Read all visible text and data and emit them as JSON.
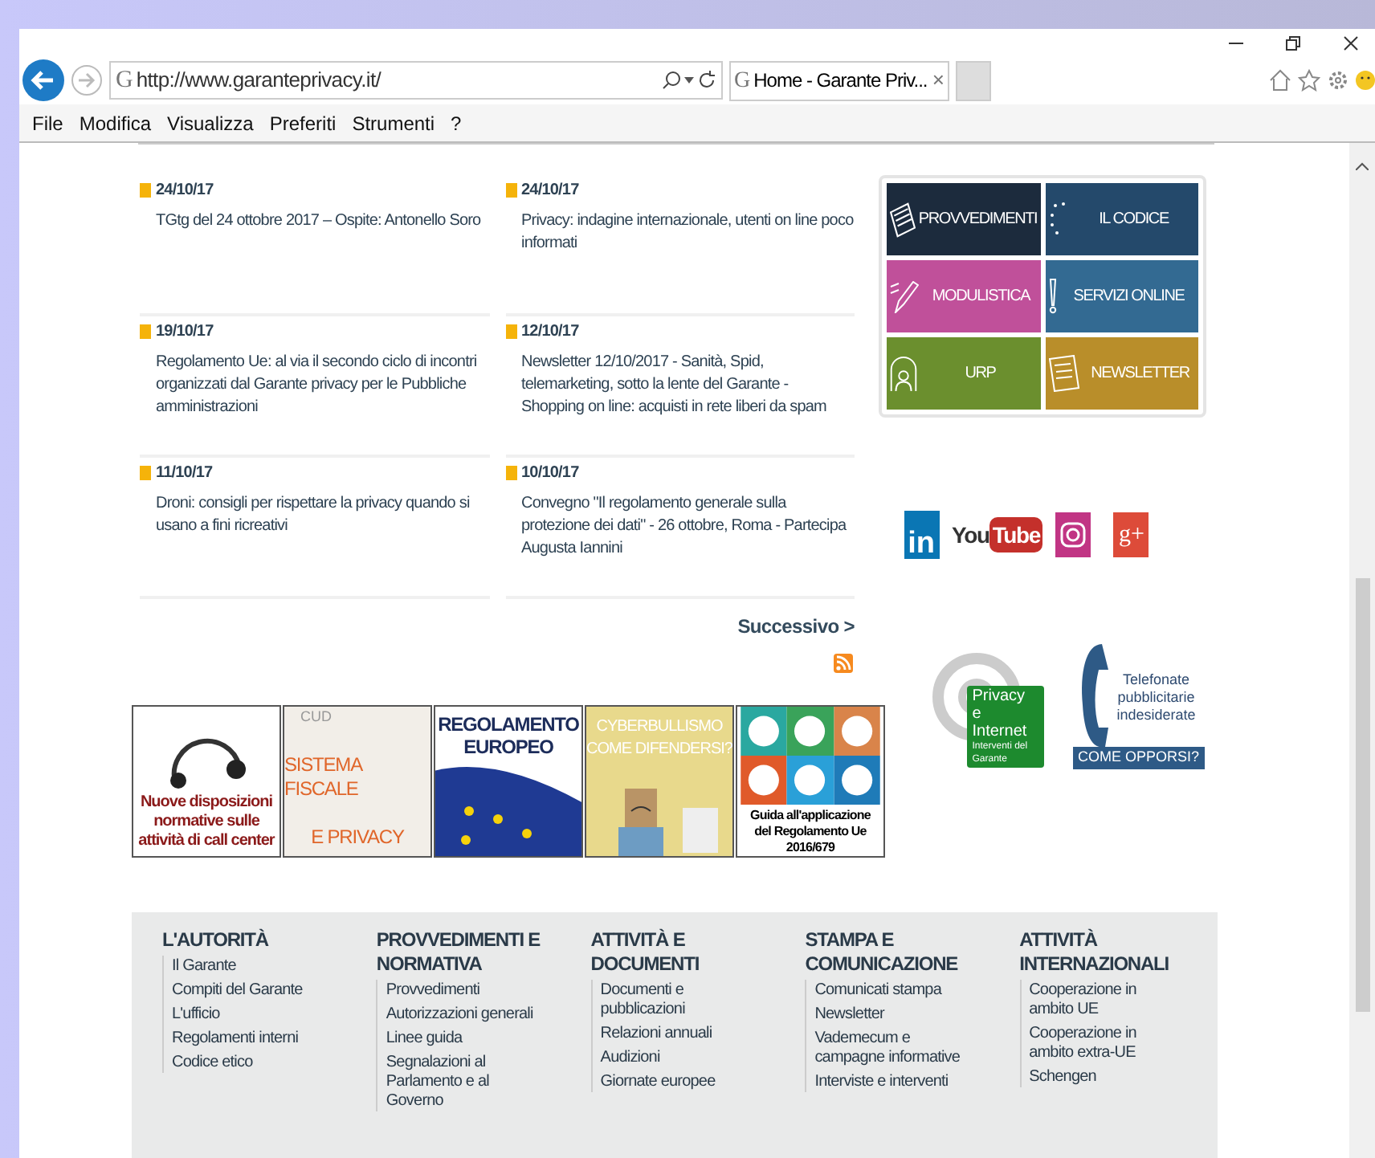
{
  "browser": {
    "site_icon": "G",
    "address": "http://www.garanteprivacy.it/",
    "tab": {
      "site_icon": "G",
      "title": "Home - Garante Priv...",
      "close": "×",
      "selected": true
    },
    "menu": [
      "File",
      "Modifica",
      "Visualizza",
      "Preferiti",
      "Strumenti",
      "?"
    ]
  },
  "news": [
    {
      "date": "24/10/17",
      "title": "TGtg del 24 ottobre 2017 – Ospite: Antonello Soro"
    },
    {
      "date": "24/10/17",
      "title": "Privacy: indagine internazionale, utenti on line poco informati"
    },
    {
      "date": "19/10/17",
      "title": "Regolamento Ue: al via il secondo ciclo di incontri organizzati dal Garante privacy per le Pubbliche amministrazioni"
    },
    {
      "date": "12/10/17",
      "title": "Newsletter 12/10/2017 - Sanità, Spid, telemarketing, sotto la lente del Garante - Shopping on line: acquisti in rete liberi da spam"
    },
    {
      "date": "11/10/17",
      "title": "Droni: consigli per rispettare la privacy quando si usano a fini ricreativi"
    },
    {
      "date": "10/10/17",
      "title": "Convegno \"Il regolamento generale sulla protezione dei dati\" - 26 ottobre, Roma - Partecipa Augusta Iannini"
    }
  ],
  "pager": "Successivo >",
  "tiles": [
    {
      "label": "PROVVEDIMENTI",
      "color": "#1c2b3d",
      "kind": "book"
    },
    {
      "label": "IL CODICE",
      "color": "#24496b",
      "kind": "stars"
    },
    {
      "label": "MODULISTICA",
      "color": "#c0509a",
      "kind": "pencil"
    },
    {
      "label": "SERVIZI ONLINE",
      "color": "#336a92",
      "kind": "exclaim"
    },
    {
      "label": "URP",
      "color": "#6b8f2e",
      "kind": "person"
    },
    {
      "label": "NEWSLETTER",
      "color": "#b98e2a",
      "kind": "paper"
    }
  ],
  "social": [
    {
      "kind": "linkedin",
      "label": "in"
    },
    {
      "kind": "youtube",
      "label": "You",
      "label2": "Tube"
    },
    {
      "kind": "instagram"
    },
    {
      "kind": "googleplus",
      "label": "g+"
    }
  ],
  "banners": [
    {
      "kind": "callcenter",
      "lines": [
        "Nuove disposizioni normative sulle attività di call center"
      ]
    },
    {
      "kind": "fiscale",
      "lines": [
        "CUD",
        "SISTEMA FISCALE",
        "E PRIVACY"
      ]
    },
    {
      "kind": "europeo",
      "lines": [
        "REGOLAMENTO",
        "EUROPEO"
      ]
    },
    {
      "kind": "cyber",
      "lines": [
        "CYBERBULLISMO",
        "COME DIFENDERSI?"
      ]
    },
    {
      "kind": "guida",
      "lines": [
        "Guida all'applicazione del Regolamento Ue 2016/679"
      ]
    }
  ],
  "badges": [
    {
      "kind": "internet",
      "lines": [
        "Privacy",
        "e Internet",
        "Interventi del Garante"
      ]
    },
    {
      "kind": "phone",
      "lines": [
        "Telefonate pubblicitarie indesiderate",
        "COME OPPORSI?"
      ]
    }
  ],
  "footer": [
    {
      "heading": "L'AUTORITÀ",
      "links": [
        "Il Garante",
        "Compiti del Garante",
        "L'ufficio",
        "Regolamenti interni",
        "Codice etico"
      ]
    },
    {
      "heading": "PROVVEDIMENTI E NORMATIVA",
      "links": [
        "Provvedimenti",
        "Autorizzazioni generali",
        "Linee guida",
        "Segnalazioni al Parlamento e al Governo"
      ]
    },
    {
      "heading": "ATTIVITÀ E DOCUMENTI",
      "links": [
        "Documenti e pubblicazioni",
        "Relazioni annuali",
        "Audizioni",
        "Giornate europee"
      ]
    },
    {
      "heading": "STAMPA E COMUNICAZIONE",
      "links": [
        "Comunicati stampa",
        "Newsletter",
        "Vademecum e campagne informative",
        "Interviste e interventi"
      ]
    },
    {
      "heading": "ATTIVITÀ INTERNAZIONALI",
      "links": [
        "Cooperazione in ambito UE",
        "Cooperazione in ambito extra-UE",
        "Schengen"
      ]
    }
  ]
}
